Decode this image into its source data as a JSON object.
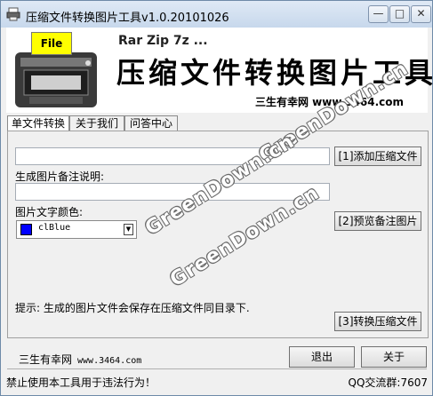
{
  "window": {
    "title": "压缩文件转换图片工具v1.0.20101026",
    "minimize": "—",
    "maximize": "□",
    "close": "✕"
  },
  "banner": {
    "badge": "File",
    "subtitle": "Rar Zip 7z ...",
    "heading": "压缩文件转换图片工具",
    "site": "三生有幸网 www.3464.com"
  },
  "tabs": [
    "单文件转换",
    "关于我们",
    "问答中心"
  ],
  "form": {
    "file_value": "",
    "note_label": "生成图片备注说明:",
    "note_value": "",
    "color_label": "图片文字颜色:",
    "color_value": "clBlue",
    "color_hex": "#0000ff",
    "add_button": "[1]添加压缩文件",
    "preview_button": "[2]预览备注图片",
    "convert_button": "[3]转换压缩文件",
    "hint": "提示: 生成的图片文件会保存在压缩文件同目录下."
  },
  "watermark": [
    "GreenDown.cn",
    "GreenDown.cn",
    "GreenDown.cn"
  ],
  "footer": {
    "site_name": "三生有幸网",
    "site_url": "www.3464.com",
    "exit_button": "退出",
    "about_button": "关于",
    "warning": "禁止使用本工具用于违法行为！",
    "qq_group": "QQ交流群:7607"
  }
}
